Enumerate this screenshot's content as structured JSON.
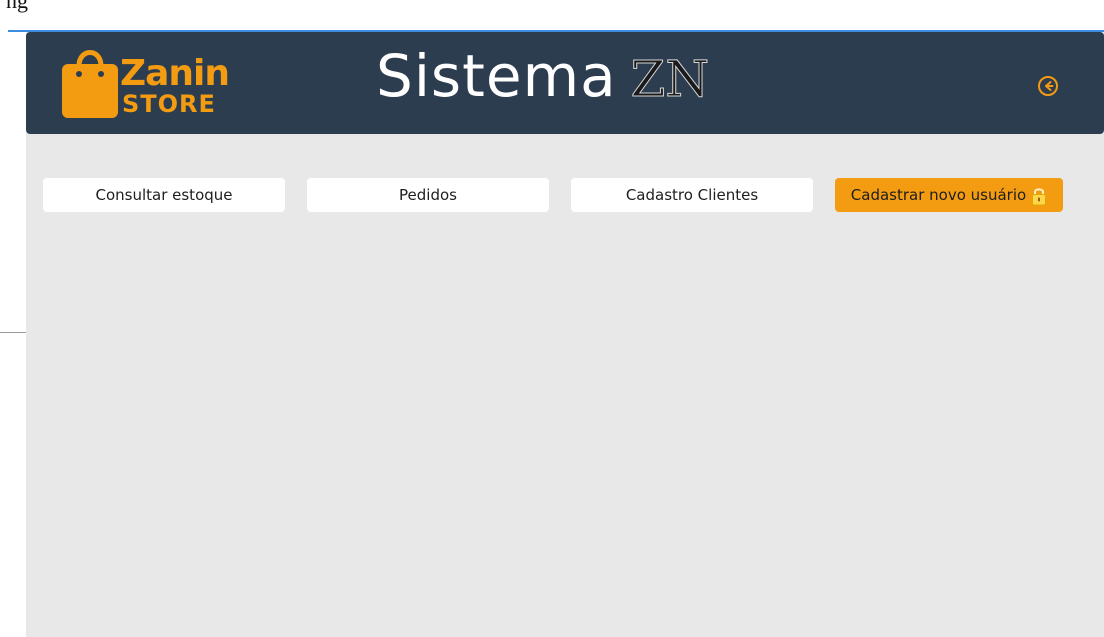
{
  "corner_text": "ng",
  "header": {
    "logo": {
      "line1": "Zanin",
      "line2": "STORE",
      "icon": "shopping-bag-icon"
    },
    "title": "Sistema",
    "title_suffix": "ZN",
    "back_icon": "arrow-left-circle-icon"
  },
  "nav": {
    "items": [
      {
        "label": "Consultar estoque"
      },
      {
        "label": "Pedidos"
      },
      {
        "label": "Cadastro Clientes"
      },
      {
        "label": "Cadastrar novo usuário",
        "icon": "lock-icon"
      }
    ]
  },
  "colors": {
    "header_bg": "#2d3d50",
    "accent": "#f39c12",
    "content_bg": "#e8e8e8",
    "top_line": "#3d8de0"
  }
}
